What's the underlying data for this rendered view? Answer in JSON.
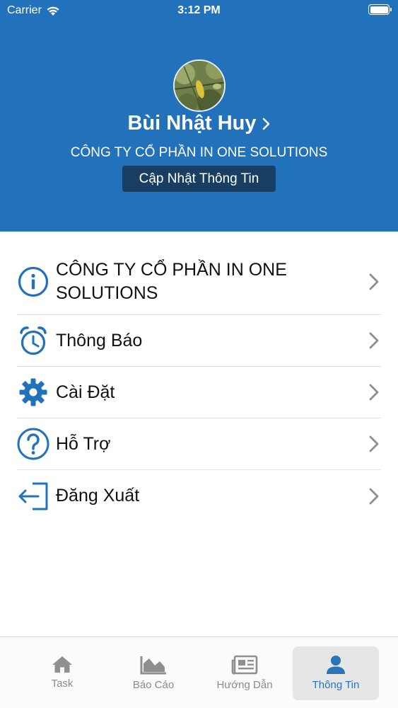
{
  "status_bar": {
    "carrier": "Carrier",
    "time": "3:12 PM"
  },
  "profile": {
    "name": "Bùi Nhật Huy",
    "company": "CÔNG TY CỔ PHẦN IN ONE SOLUTIONS",
    "update_button": "Cập Nhật Thông Tin"
  },
  "menu": {
    "items": [
      {
        "label": "CÔNG TY CỔ PHẦN IN ONE SOLUTIONS",
        "icon": "info-icon"
      },
      {
        "label": "Thông Báo",
        "icon": "alarm-clock-icon"
      },
      {
        "label": "Cài Đặt",
        "icon": "gear-icon"
      },
      {
        "label": "Hỗ Trợ",
        "icon": "question-icon"
      },
      {
        "label": "Đăng Xuất",
        "icon": "logout-icon"
      }
    ]
  },
  "tabbar": {
    "tabs": [
      {
        "label": "Task",
        "icon": "home-icon"
      },
      {
        "label": "Báo Cáo",
        "icon": "area-chart-icon"
      },
      {
        "label": "Hướng Dẫn",
        "icon": "newspaper-icon"
      },
      {
        "label": "Thông Tin",
        "icon": "user-icon"
      }
    ],
    "active_index": 3
  },
  "colors": {
    "header_bg": "#2271bb",
    "update_button_bg": "#183f63",
    "icon_blue": "#2271bb",
    "active_tab_text": "#2a74bb"
  }
}
